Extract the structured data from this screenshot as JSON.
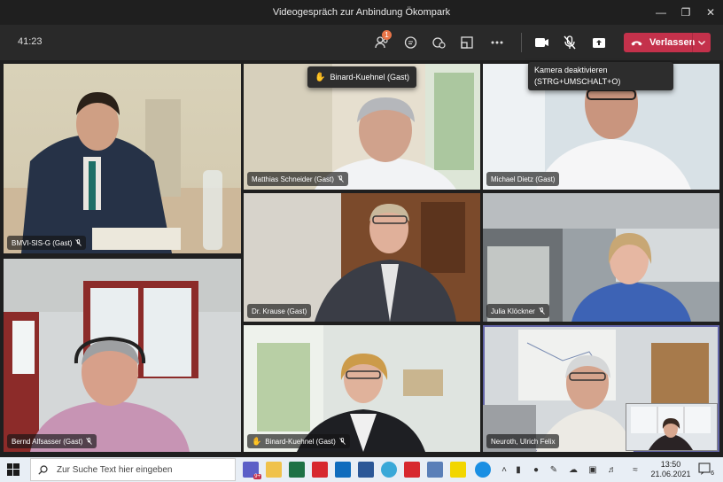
{
  "window": {
    "title": "Videogespräch zur Anbindung Ökompark"
  },
  "toolbar": {
    "timer": "41:23",
    "participants_badge": "1",
    "leave_label": "Verlassen",
    "icons": [
      "participants-icon",
      "chat-icon",
      "reactions-icon",
      "rooms-icon",
      "more-icon",
      "camera-icon",
      "mic-off-icon",
      "share-icon"
    ]
  },
  "tooltips": {
    "raised_hand": "Binard-Kuehnel (Gast)",
    "camera_title": "Kamera deaktivieren",
    "camera_shortcut": "(STRG+UMSCHALT+O)"
  },
  "participants": [
    {
      "name": "BMVI-SIS-G (Gast)"
    },
    {
      "name": "Matthias Schneider (Gast)"
    },
    {
      "name": "Michael Dietz (Gast)"
    },
    {
      "name": "Dr. Krause (Gast)"
    },
    {
      "name": "Julia Klöckner"
    },
    {
      "name": "Bernd Alfsasser (Gast)"
    },
    {
      "name": "Binard-Kuehnel (Gast)"
    },
    {
      "name": "Neuroth, Ulrich Felix"
    }
  ],
  "taskbar": {
    "search_placeholder": "Zur Suche Text hier eingeben",
    "time": "13:50",
    "date": "21.06.2021",
    "teams_badge": "9+",
    "notification_count": "6"
  },
  "colors": {
    "leave_red": "#c4314b",
    "accent": "#6264a7",
    "toolbar_bg": "#292929"
  }
}
